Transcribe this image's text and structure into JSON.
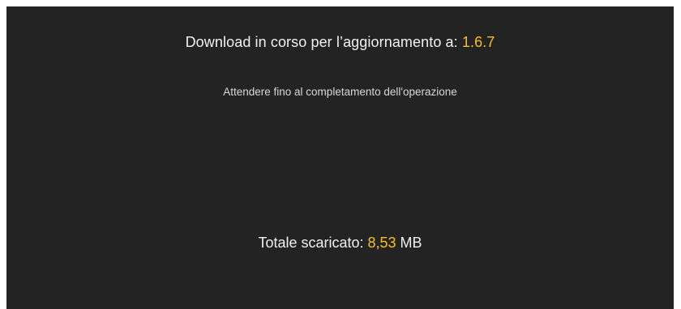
{
  "update": {
    "title_prefix": "Download in corso per l’aggiornamento a: ",
    "version": "1.6.7",
    "subtitle": "Attendere fino al completamento dell'operazione"
  },
  "download": {
    "total_label": "Totale scaricato: ",
    "amount": "8,53",
    "unit": " MB"
  },
  "colors": {
    "background": "#232323",
    "text": "#f2f2f2",
    "accent": "#f7c21b"
  }
}
